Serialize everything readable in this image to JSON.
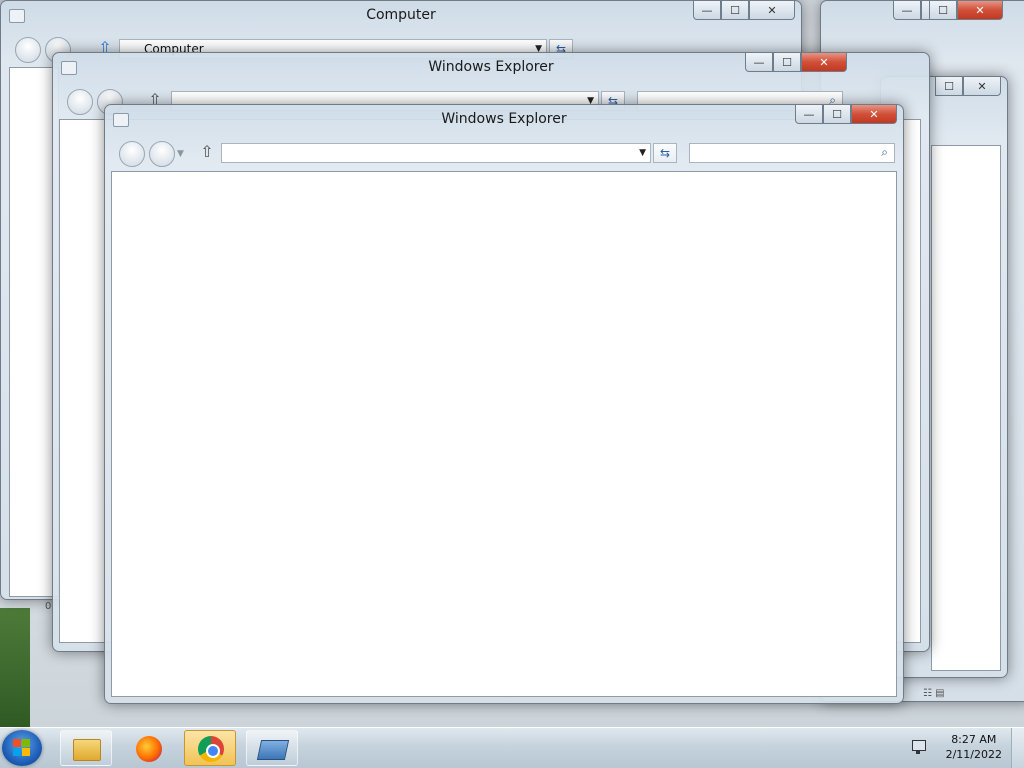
{
  "windows": {
    "computer": {
      "title": "Computer",
      "address": "Computer"
    },
    "explorer_mid": {
      "title": "Windows Explorer",
      "address": ""
    },
    "explorer_front": {
      "title": "Windows Explorer",
      "address": "",
      "search_placeholder": ""
    }
  },
  "caption_buttons": {
    "minimize": "—",
    "maximize": "☐",
    "close": "✕"
  },
  "status_fragment": "0",
  "taskbar": {
    "pinned": [
      "explorer-icon",
      "firefox-icon",
      "chrome-icon",
      "explorer-window-icon"
    ],
    "clock_time": "8:27 AM",
    "clock_date": "2/11/2022"
  }
}
